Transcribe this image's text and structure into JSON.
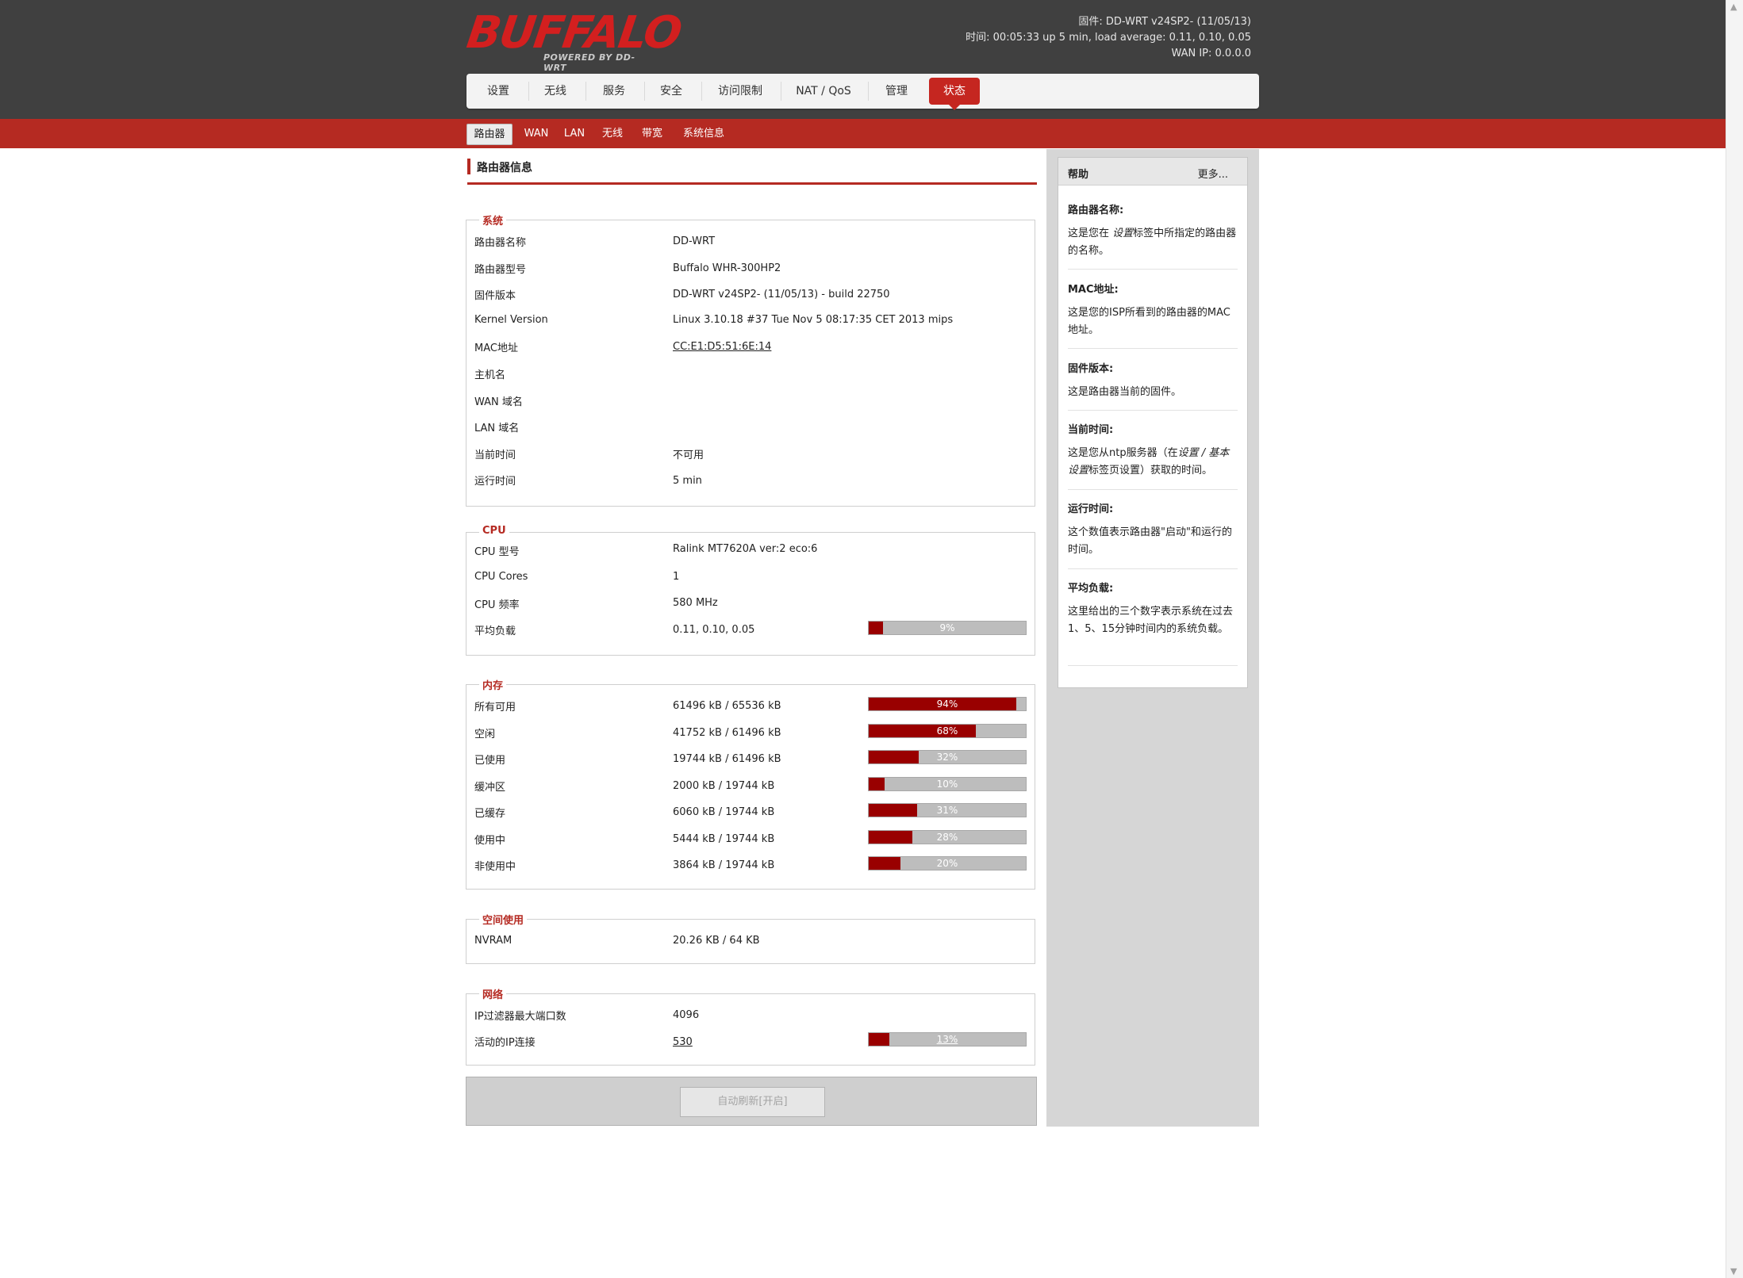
{
  "branding": {
    "logo": "BUFFALO",
    "logo_sub": "POWERED BY DD-WRT"
  },
  "header_info": {
    "firmware": "固件: DD-WRT v24SP2- (11/05/13)",
    "time": "时间: 00:05:33 up 5 min, load average: 0.11, 0.10, 0.05",
    "wan_ip": "WAN IP: 0.0.0.0"
  },
  "main_nav": [
    "设置",
    "无线",
    "服务",
    "安全",
    "访问限制",
    "NAT / QoS",
    "管理",
    "状态"
  ],
  "sub_nav": [
    "路由器",
    "WAN",
    "LAN",
    "无线",
    "带宽",
    "系统信息"
  ],
  "page_title": "路由器信息",
  "system": {
    "legend": "系统",
    "rows": [
      {
        "label": "路由器名称",
        "value": "DD-WRT"
      },
      {
        "label": "路由器型号",
        "value": "Buffalo WHR-300HP2"
      },
      {
        "label": "固件版本",
        "value": "DD-WRT v24SP2- (11/05/13) - build 22750"
      },
      {
        "label": "Kernel Version",
        "value": "Linux 3.10.18 #37 Tue Nov 5 08:17:35 CET 2013 mips"
      },
      {
        "label": "MAC地址",
        "value": "CC:E1:D5:51:6E:14"
      },
      {
        "label": "主机名",
        "value": ""
      },
      {
        "label": "WAN 域名",
        "value": ""
      },
      {
        "label": "LAN 域名",
        "value": ""
      },
      {
        "label": "当前时间",
        "value": "不可用"
      },
      {
        "label": "运行时间",
        "value": "5 min"
      }
    ]
  },
  "cpu": {
    "legend": "CPU",
    "rows": [
      {
        "label": "CPU 型号",
        "value": "Ralink MT7620A ver:2 eco:6"
      },
      {
        "label": "CPU Cores",
        "value": "1"
      },
      {
        "label": "CPU 频率",
        "value": "580 MHz"
      },
      {
        "label": "平均负载",
        "value": "0.11, 0.10, 0.05",
        "meter": 9,
        "meter_text": "9%"
      }
    ]
  },
  "memory": {
    "legend": "内存",
    "rows": [
      {
        "label": "所有可用",
        "value": "61496 kB / 65536 kB",
        "meter": 94,
        "meter_text": "94%"
      },
      {
        "label": "空闲",
        "value": "41752 kB / 61496 kB",
        "meter": 68,
        "meter_text": "68%"
      },
      {
        "label": "已使用",
        "value": "19744 kB / 61496 kB",
        "meter": 32,
        "meter_text": "32%"
      },
      {
        "label": "缓冲区",
        "value": "2000 kB / 19744 kB",
        "meter": 10,
        "meter_text": "10%"
      },
      {
        "label": "已缓存",
        "value": "6060 kB / 19744 kB",
        "meter": 31,
        "meter_text": "31%"
      },
      {
        "label": "使用中",
        "value": "5444 kB / 19744 kB",
        "meter": 28,
        "meter_text": "28%"
      },
      {
        "label": "非使用中",
        "value": "3864 kB / 19744 kB",
        "meter": 20,
        "meter_text": "20%"
      }
    ]
  },
  "space": {
    "legend": "空间使用",
    "rows": [
      {
        "label": "NVRAM",
        "value": "20.26 KB / 64 KB"
      }
    ]
  },
  "network": {
    "legend": "网络",
    "rows": [
      {
        "label": "IP过滤器最大端口数",
        "value": "4096"
      },
      {
        "label": "活动的IP连接",
        "value": "530",
        "meter": 13,
        "meter_text": "13%"
      }
    ]
  },
  "auto_refresh_label": "自动刷新[开启]",
  "help": {
    "title": "帮助",
    "more": "更多...",
    "entries": [
      {
        "title": "路由器名称:",
        "body_pre": "这是您在 ",
        "body_em": "设置",
        "body_post": "标签中所指定的路由器的名称。"
      },
      {
        "title": "MAC地址:",
        "body": "这是您的ISP所看到的路由器的MAC地址。"
      },
      {
        "title": "固件版本:",
        "body": "这是路由器当前的固件。"
      },
      {
        "title": "当前时间:",
        "body_pre": "这是您从ntp服务器（在",
        "body_em": "设置 / 基本设置",
        "body_post": "标签页设置）获取的时间。"
      },
      {
        "title": "运行时间:",
        "body": "这个数值表示路由器\"启动\"和运行的时间。"
      },
      {
        "title": "平均负载:",
        "body": "这里给出的三个数字表示系统在过去1、5、15分钟时间内的系统负载。"
      }
    ]
  },
  "colors": {
    "accent": "#b52a22",
    "header_bg": "#404040",
    "meter_fill": "#990000",
    "meter_bg": "#bdbdbd"
  }
}
